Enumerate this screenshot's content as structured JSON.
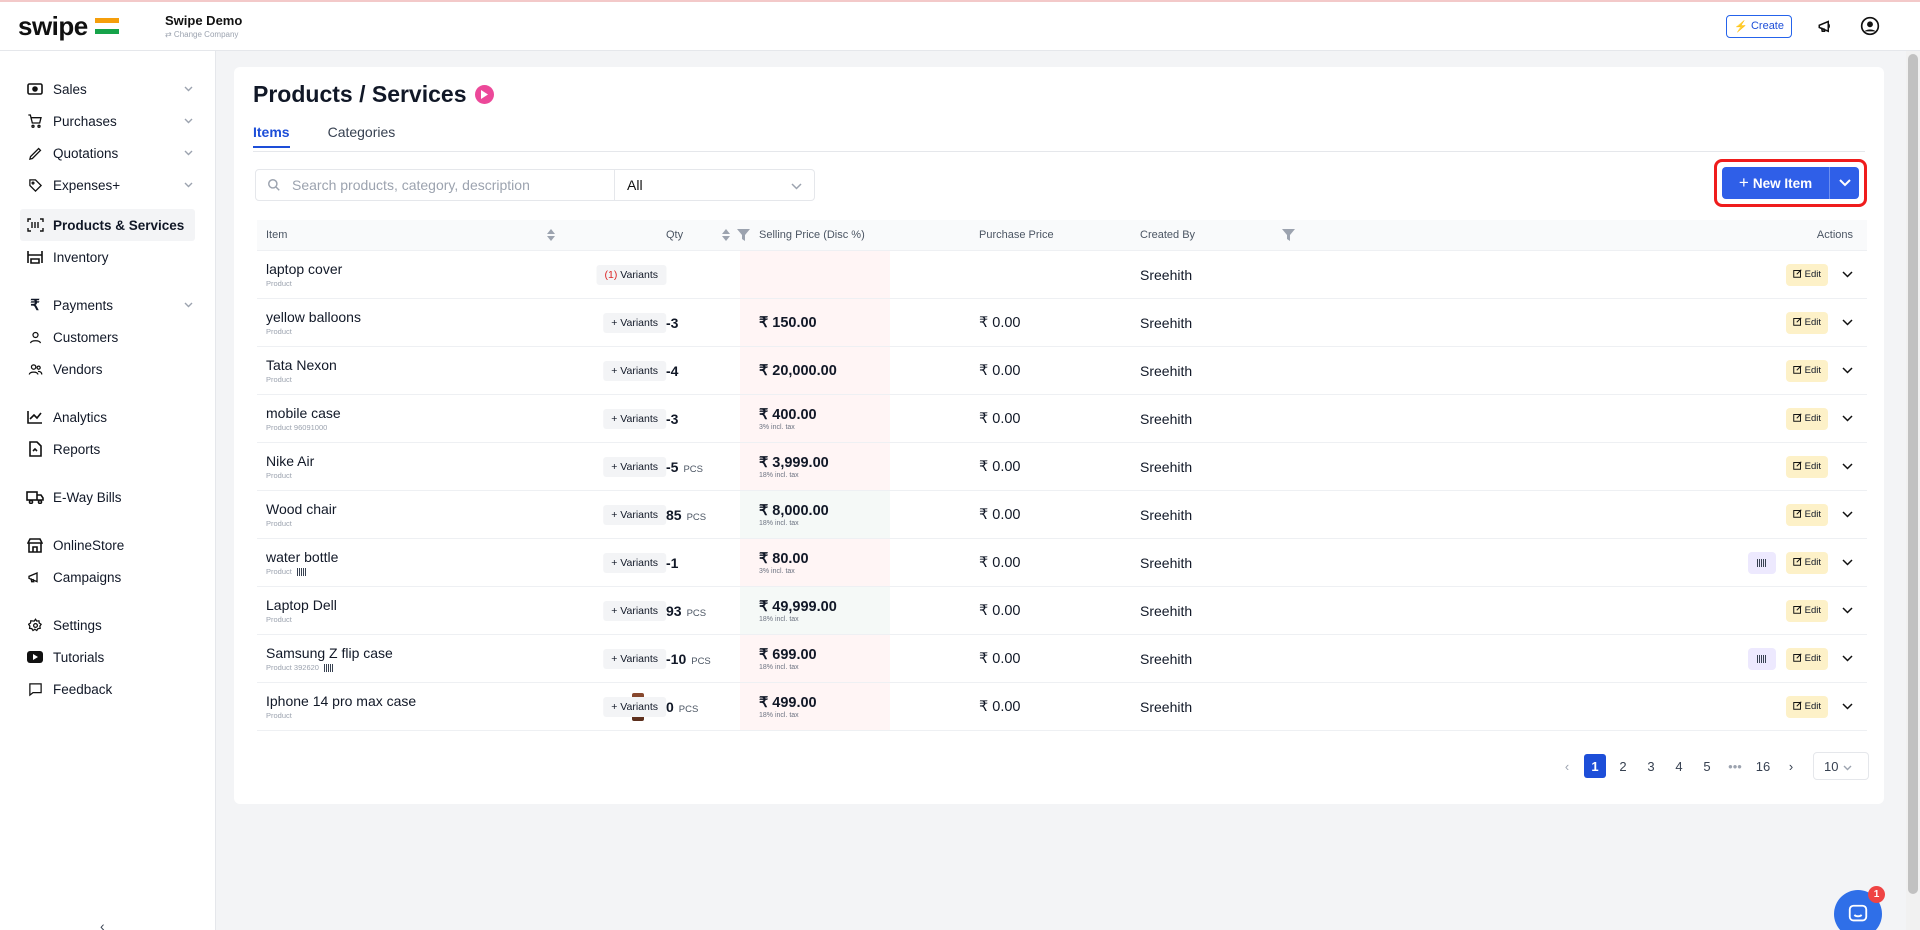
{
  "header": {
    "logo_text": "swipe",
    "company_name": "Swipe Demo",
    "change_company": "⇄ Change Company",
    "create_label": "Create"
  },
  "sidebar": {
    "items": [
      {
        "label": "Sales",
        "icon": "cash-icon",
        "has_chevron": true
      },
      {
        "label": "Purchases",
        "icon": "cart-icon",
        "has_chevron": true
      },
      {
        "label": "Quotations",
        "icon": "pencil-icon",
        "has_chevron": true
      },
      {
        "label": "Expenses+",
        "icon": "tag-icon",
        "has_chevron": true
      },
      {
        "label": "Products & Services",
        "icon": "barcode-icon",
        "active": true
      },
      {
        "label": "Inventory",
        "icon": "warehouse-icon"
      },
      {
        "label": "Payments",
        "icon": "rupee-icon",
        "has_chevron": true
      },
      {
        "label": "Customers",
        "icon": "user-icon"
      },
      {
        "label": "Vendors",
        "icon": "users-icon"
      },
      {
        "label": "Analytics",
        "icon": "chart-icon"
      },
      {
        "label": "Reports",
        "icon": "report-icon"
      },
      {
        "label": "E-Way Bills",
        "icon": "truck-icon"
      },
      {
        "label": "OnlineStore",
        "icon": "store-icon"
      },
      {
        "label": "Campaigns",
        "icon": "megaphone-icon"
      },
      {
        "label": "Settings",
        "icon": "gear-icon"
      },
      {
        "label": "Tutorials",
        "icon": "youtube-icon"
      },
      {
        "label": "Feedback",
        "icon": "chat-bubble-icon"
      }
    ],
    "collapse_label": "‹"
  },
  "page": {
    "title": "Products / Services",
    "tabs": [
      {
        "label": "Items",
        "active": true
      },
      {
        "label": "Categories",
        "active": false
      }
    ],
    "search_placeholder": "Search products, category, description",
    "filter_value": "All",
    "new_item_label": "New Item"
  },
  "table": {
    "headers": {
      "item": "Item",
      "qty": "Qty",
      "selling_price": "Selling Price (Disc %)",
      "purchase_price": "Purchase Price",
      "created_by": "Created By",
      "actions": "Actions"
    },
    "rows": [
      {
        "name": "laptop cover",
        "sub": "Product",
        "variants": "Variants",
        "variant_count": "(1)",
        "qty": "",
        "unit": "",
        "price": "",
        "tax": "",
        "purchase": "",
        "creator": "Sreehith",
        "barcode_btn": false,
        "thumb": false,
        "qty_tint": "#fff5f5"
      },
      {
        "name": "yellow balloons",
        "sub": "Product",
        "variants": "+ Variants",
        "variant_count": "",
        "qty": "-3",
        "unit": "",
        "price": "₹ 150.00",
        "tax": "",
        "purchase": "₹ 0.00",
        "creator": "Sreehith",
        "barcode_btn": false,
        "thumb": false,
        "qty_tint": "#fff5f5"
      },
      {
        "name": "Tata Nexon",
        "sub": "Product",
        "variants": "+ Variants",
        "variant_count": "",
        "qty": "-4",
        "unit": "",
        "price": "₹ 20,000.00",
        "tax": "",
        "purchase": "₹ 0.00",
        "creator": "Sreehith",
        "barcode_btn": false,
        "thumb": false,
        "qty_tint": "#fff5f5"
      },
      {
        "name": "mobile case",
        "sub": "Product  96091000",
        "variants": "+ Variants",
        "variant_count": "",
        "qty": "-3",
        "unit": "",
        "price": "₹ 400.00",
        "tax": "3% incl. tax",
        "purchase": "₹ 0.00",
        "creator": "Sreehith",
        "barcode_btn": false,
        "thumb": false,
        "qty_tint": "#fff5f5"
      },
      {
        "name": "Nike Air",
        "sub": "Product",
        "variants": "+ Variants",
        "variant_count": "",
        "qty": "-5",
        "unit": "PCS",
        "price": "₹ 3,999.00",
        "tax": "18% incl. tax",
        "purchase": "₹ 0.00",
        "creator": "Sreehith",
        "barcode_btn": false,
        "thumb": false,
        "qty_tint": "#fff5f5"
      },
      {
        "name": "Wood chair",
        "sub": "Product",
        "variants": "+ Variants",
        "variant_count": "",
        "qty": "85",
        "unit": "PCS",
        "price": "₹ 8,000.00",
        "tax": "18% incl. tax",
        "purchase": "₹ 0.00",
        "creator": "Sreehith",
        "barcode_btn": false,
        "thumb": false,
        "qty_tint": "#f5f9f7"
      },
      {
        "name": "water bottle",
        "sub": "Product",
        "variants": "+ Variants",
        "variant_count": "",
        "qty": "-1",
        "unit": "",
        "price": "₹ 80.00",
        "tax": "3% incl. tax",
        "purchase": "₹ 0.00",
        "creator": "Sreehith",
        "barcode_btn": true,
        "sub_barcode": true,
        "thumb": false,
        "qty_tint": "#fff5f5"
      },
      {
        "name": "Laptop Dell",
        "sub": "Product",
        "variants": "+ Variants",
        "variant_count": "",
        "qty": "93",
        "unit": "PCS",
        "price": "₹ 49,999.00",
        "tax": "18% incl. tax",
        "purchase": "₹ 0.00",
        "creator": "Sreehith",
        "barcode_btn": false,
        "thumb": false,
        "qty_tint": "#f5f9f7"
      },
      {
        "name": "Samsung Z flip case",
        "sub": "Product  392620",
        "variants": "+ Variants",
        "variant_count": "",
        "qty": "-10",
        "unit": "PCS",
        "price": "₹ 699.00",
        "tax": "18% incl. tax",
        "purchase": "₹ 0.00",
        "creator": "Sreehith",
        "barcode_btn": true,
        "sub_barcode": true,
        "thumb": false,
        "qty_tint": "#fff5f5"
      },
      {
        "name": "Iphone 14 pro max case",
        "sub": "Product",
        "variants": "+ Variants",
        "variant_count": "",
        "qty": "0",
        "unit": "PCS",
        "price": "₹ 499.00",
        "tax": "18% incl. tax",
        "purchase": "₹ 0.00",
        "creator": "Sreehith",
        "barcode_btn": false,
        "thumb": true,
        "qty_tint": "#fff5f5"
      }
    ],
    "edit_label": "Edit"
  },
  "pagination": {
    "pages": [
      "1",
      "2",
      "3",
      "4",
      "5",
      "•••",
      "16"
    ],
    "current": "1",
    "page_size": "10"
  },
  "chat": {
    "badge": "1"
  },
  "colors": {
    "accent": "#2f5fe8",
    "highlight_border": "#ef1c1c",
    "edit_bg": "#fdf1c8"
  }
}
